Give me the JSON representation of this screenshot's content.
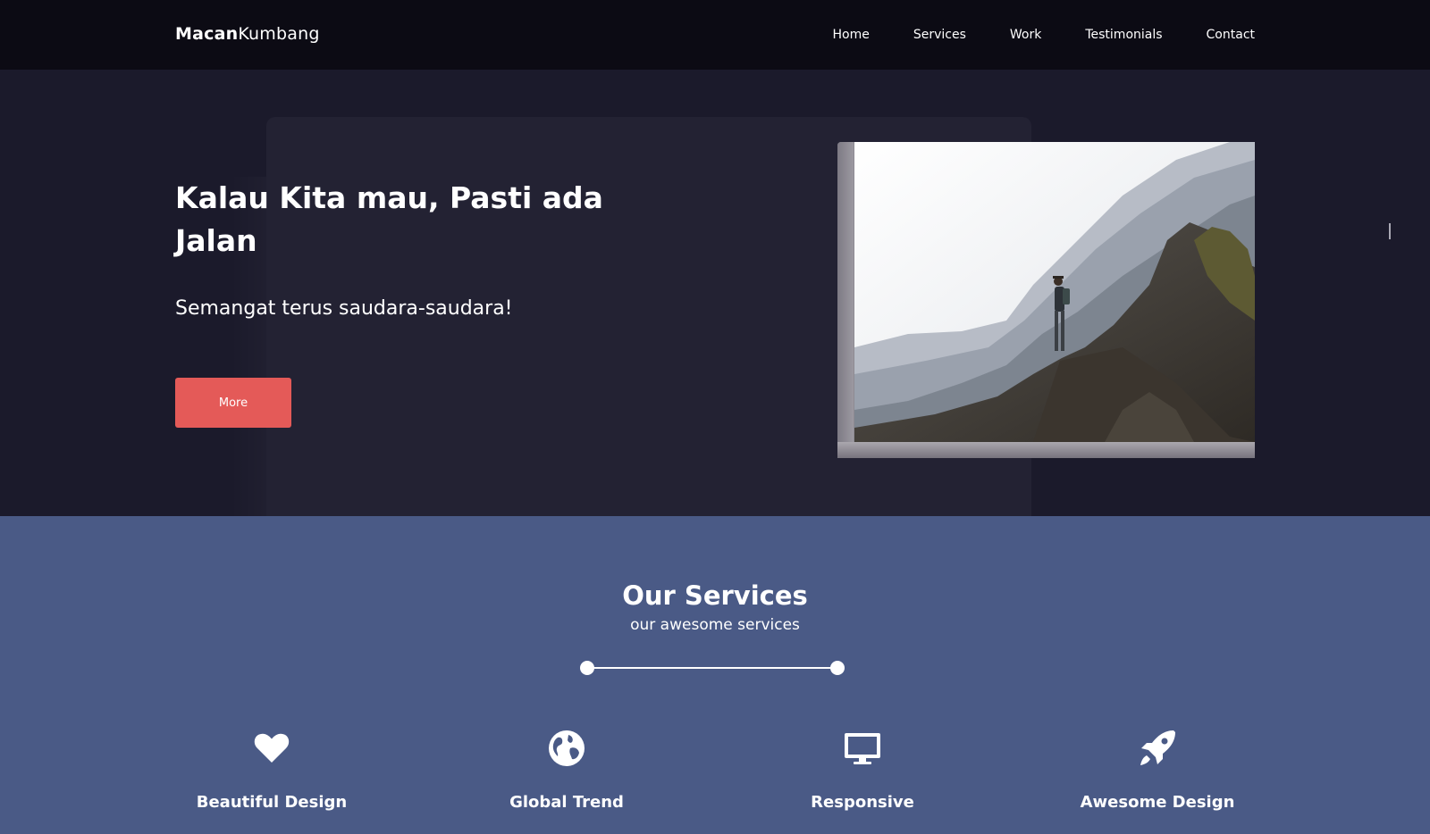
{
  "brand": {
    "bold": "Macan",
    "rest": "Kumbang"
  },
  "nav": {
    "items": [
      "Home",
      "Services",
      "Work",
      "Testimonials",
      "Contact"
    ]
  },
  "hero": {
    "title": "Kalau Kita mau, Pasti ada Jalan",
    "subtitle": "Semangat terus saudara-saudara!",
    "button": "More"
  },
  "services": {
    "title": "Our Services",
    "subtitle": "our awesome services",
    "items": [
      {
        "label": "Beautiful Design",
        "icon": "heart-icon"
      },
      {
        "label": "Global Trend",
        "icon": "globe-icon"
      },
      {
        "label": "Responsive",
        "icon": "monitor-icon"
      },
      {
        "label": "Awesome Design",
        "icon": "rocket-icon"
      }
    ]
  },
  "colors": {
    "nav_bg": "#0c0b14",
    "hero_bg": "#1b1a2b",
    "panel_bg": "#232233",
    "accent": "#e45a58",
    "services_bg": "#4a5a86"
  }
}
